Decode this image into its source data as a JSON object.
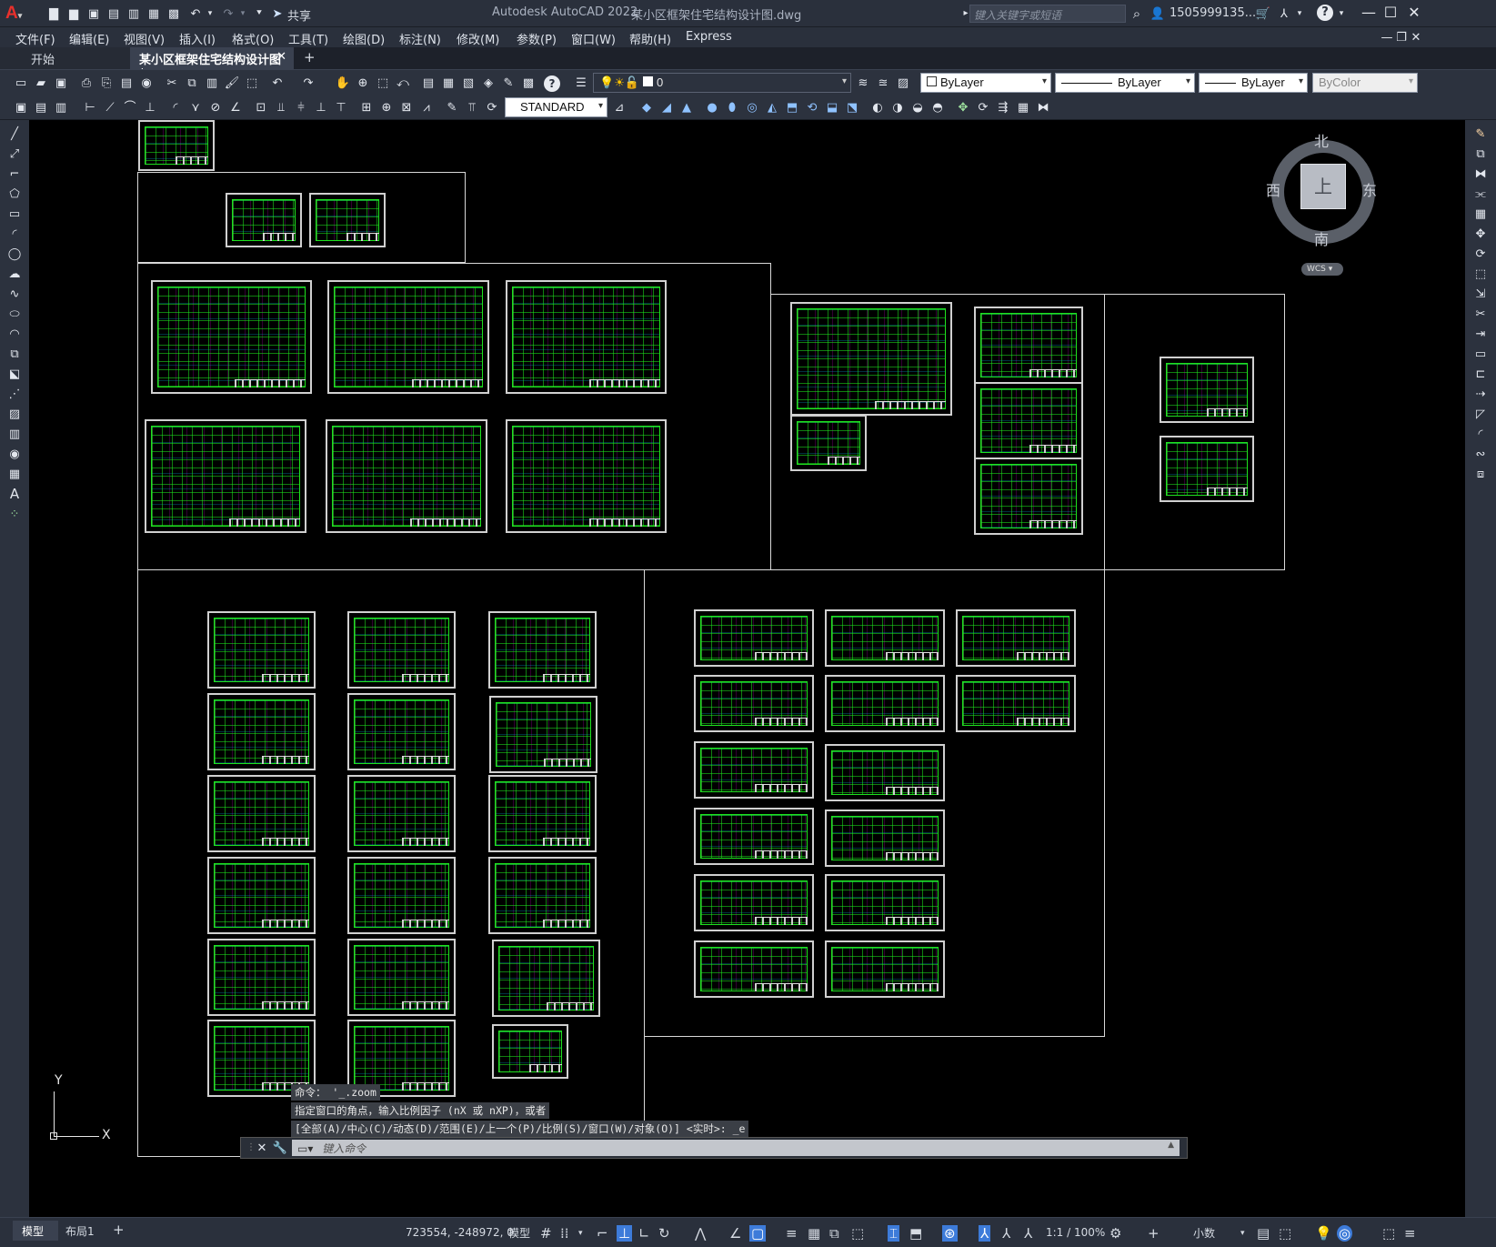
{
  "app": {
    "title": "Autodesk AutoCAD 2022",
    "file": "某小区框架住宅结构设计图.dwg",
    "search_placeholder": "键入关键字或短语",
    "user": "1505999135...",
    "share": "共享"
  },
  "menu": [
    "文件(F)",
    "编辑(E)",
    "视图(V)",
    "插入(I)",
    "格式(O)",
    "工具(T)",
    "绘图(D)",
    "标注(N)",
    "修改(M)",
    "参数(P)",
    "窗口(W)",
    "帮助(H)",
    "Express"
  ],
  "tabs": {
    "start": "开始",
    "drawing": "某小区框架住宅结构设计图*",
    "add": "+"
  },
  "properties": {
    "layer": "0",
    "color": "ByLayer",
    "linetype": "ByLayer",
    "lineweight": "ByLayer",
    "plotstyle": "ByColor",
    "textstyle": "STANDARD"
  },
  "viewcube": {
    "north": "北",
    "south": "南",
    "east": "东",
    "west": "西",
    "top": "上",
    "wcs": "WCS"
  },
  "ucs": {
    "x": "X",
    "y": "Y"
  },
  "command": {
    "line1": "命令： '_.zoom",
    "line2": "指定窗口的角点，输入比例因子 (nX 或 nXP)，或者",
    "line3": "[全部(A)/中心(C)/动态(D)/范围(E)/上一个(P)/比例(S)/窗口(W)/对象(O)] <实时>: _e",
    "placeholder": "键入命令"
  },
  "status": {
    "model_tab": "模型",
    "layout_tab": "布局1",
    "add": "+",
    "coords": "723554, -248972, 0",
    "mode": "模型",
    "scale": "1:1 / 100%",
    "units": "小数"
  }
}
